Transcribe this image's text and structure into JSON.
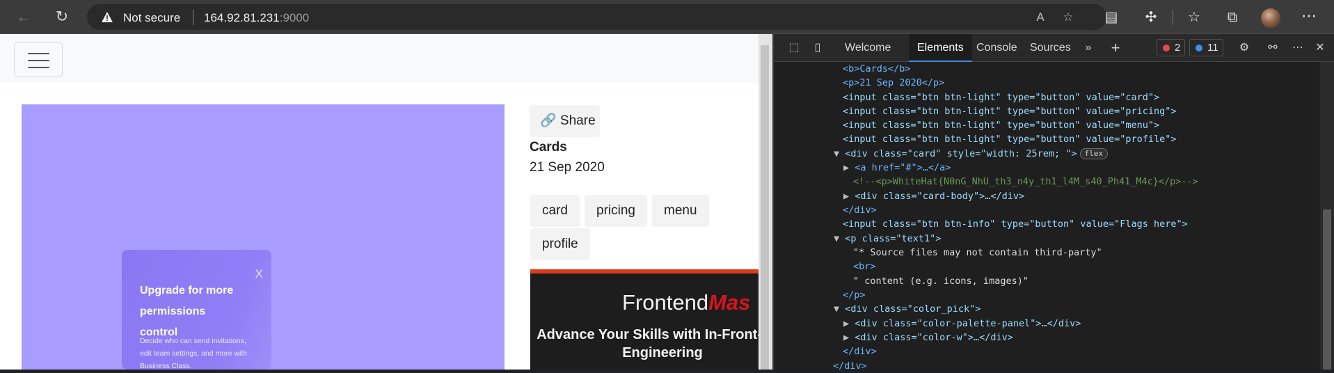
{
  "browser": {
    "security_label": "Not secure",
    "url_host": "164.92.81.231",
    "url_port": ":9000"
  },
  "page": {
    "share_label": "🔗 Share",
    "title": "Cards",
    "date": "21 Sep 2020",
    "tags": [
      "card",
      "pricing",
      "menu",
      "profile"
    ],
    "modal": {
      "close": "X",
      "title": "Upgrade for more permissions control",
      "text": "Decide who can send invitations, edit team settings, and more with Business Class."
    },
    "banner": {
      "logo_part1": "Frontend",
      "logo_part2": "Mas",
      "headline": "Advance Your Skills with In-Front-End Engineering"
    }
  },
  "devtools": {
    "tabs": [
      "Welcome",
      "Elements",
      "Console",
      "Sources"
    ],
    "errors": "2",
    "messages": "11",
    "flex_badge": "flex",
    "lines": {
      "l1": "<b>Cards</b>",
      "l2": "<p>21 Sep 2020</p>",
      "l3": "<input class=\"btn btn-light\" type=\"button\" value=\"card\">",
      "l4": "<input class=\"btn btn-light\" type=\"button\" value=\"pricing\">",
      "l5": "<input class=\"btn btn-light\" type=\"button\" value=\"menu\">",
      "l6": "<input class=\"btn btn-light\" type=\"button\" value=\"profile\">",
      "l7": "<div class=\"card\" style=\"width: 25rem; \">",
      "l8": "<a href=\"#\">…</a>",
      "l9": "<!--<p>WhiteHat{N0nG_NhU_th3_n4y_th1_l4M_s40_Ph41_M4c}</p>-->",
      "l10": "<div class=\"card-body\">…</div>",
      "l11": "</div>",
      "l12": "<input class=\"btn btn-info\" type=\"button\" value=\"Flags here\">",
      "l13": "<p class=\"text1\">",
      "l14": "\"* Source files may not contain third-party\"",
      "l15": "<br>",
      "l16": "\" content (e.g. icons, images)\"",
      "l17": "</p>",
      "l18": "<div class=\"color_pick\">",
      "l19": "<div class=\"color-palette-panel\">…</div>",
      "l20": "<div class=\"color-w\">…</div>",
      "l21": "</div>",
      "l22": "</div>"
    }
  }
}
